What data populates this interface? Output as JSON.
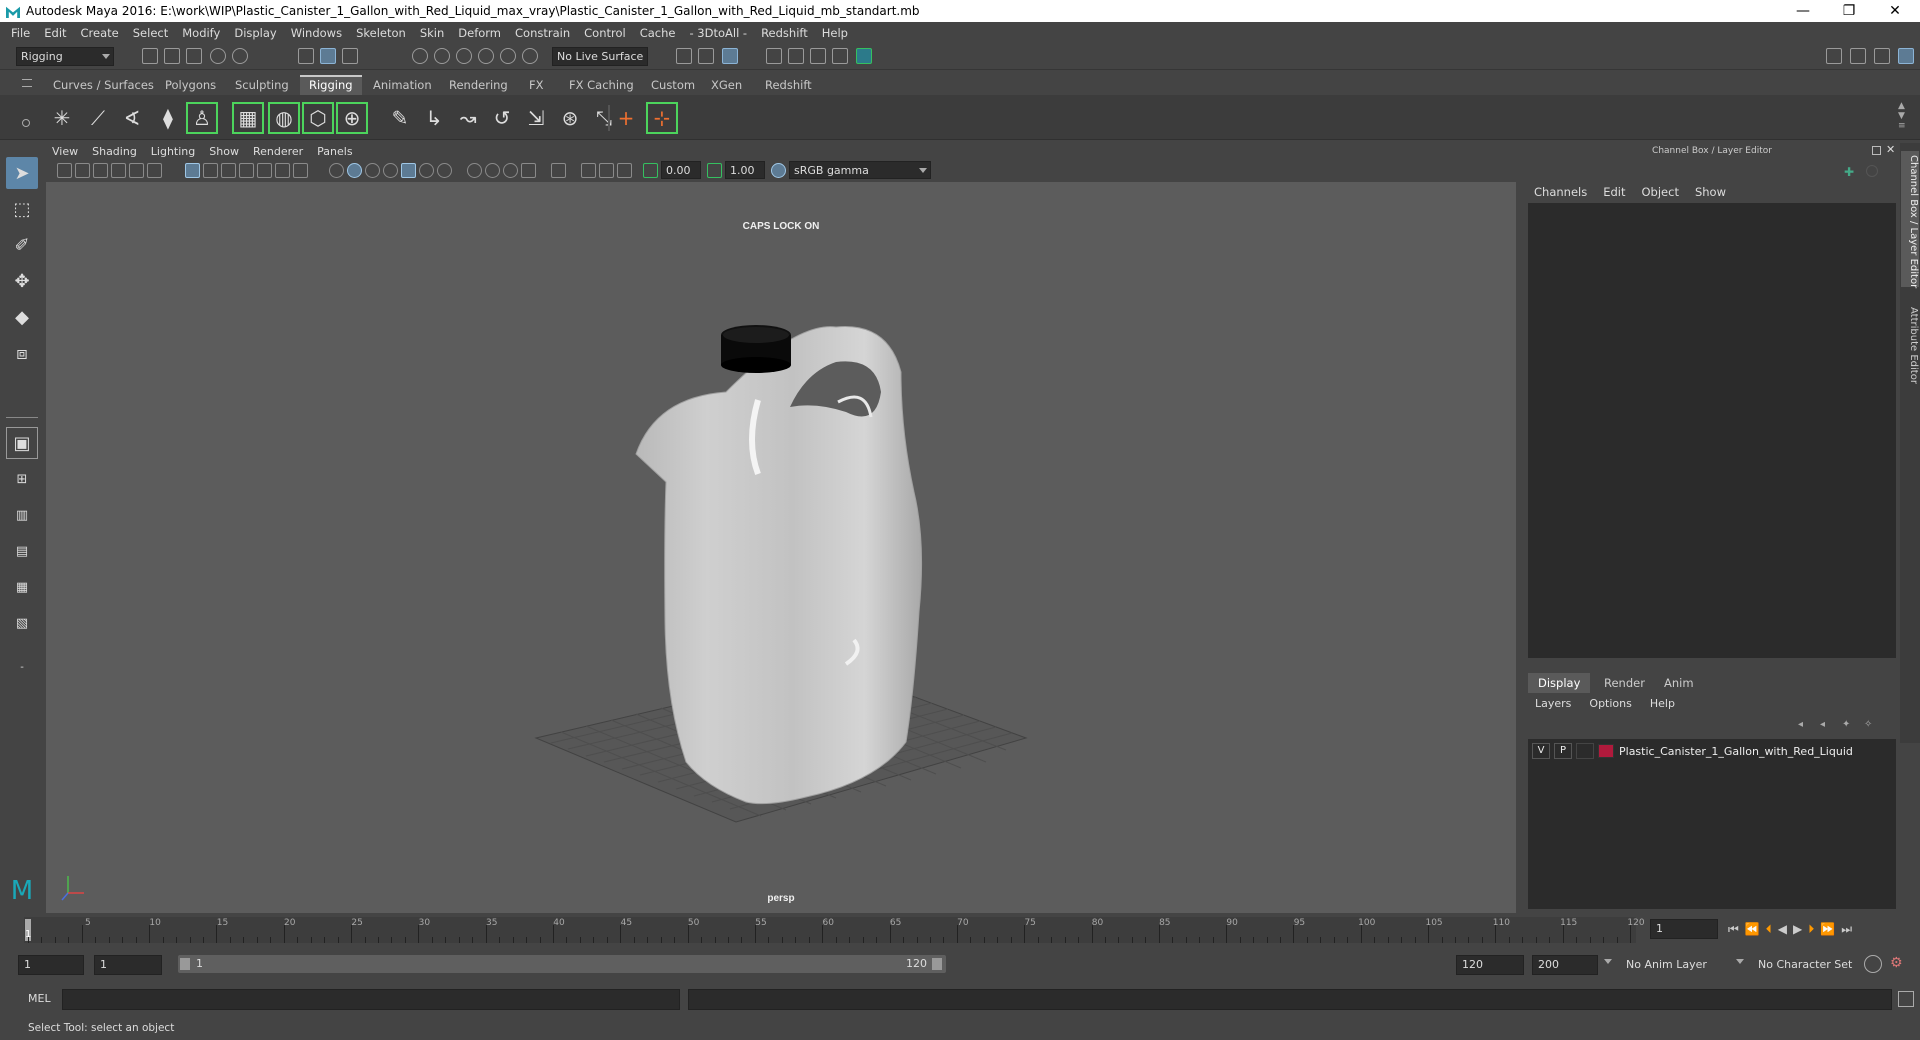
{
  "window": {
    "title": "Autodesk Maya 2016: E:\\work\\WIP\\Plastic_Canister_1_Gallon_with_Red_Liquid_max_vray\\Plastic_Canister_1_Gallon_with_Red_Liquid_mb_standart.mb",
    "minimize": "—",
    "restore": "❐",
    "close": "✕"
  },
  "menubar": [
    "File",
    "Edit",
    "Create",
    "Select",
    "Modify",
    "Display",
    "Windows",
    "Skeleton",
    "Skin",
    "Deform",
    "Constrain",
    "Control",
    "Cache",
    "- 3DtoAll -",
    "Redshift",
    "Help"
  ],
  "statusline": {
    "mode": "Rigging",
    "live_surface": "No Live Surface"
  },
  "shelf_tabs": [
    "Curves / Surfaces",
    "Polygons",
    "Sculpting",
    "Rigging",
    "Animation",
    "Rendering",
    "FX",
    "FX Caching",
    "Custom",
    "XGen",
    "Redshift"
  ],
  "shelf_active": "Rigging",
  "panel_menu": [
    "View",
    "Shading",
    "Lighting",
    "Show",
    "Renderer",
    "Panels"
  ],
  "panel_toolbar": {
    "exposure": "0.00",
    "gamma": "1.00",
    "colorspace": "sRGB gamma"
  },
  "viewport": {
    "caps_message": "CAPS LOCK ON",
    "camera": "persp"
  },
  "channel_box": {
    "title": "Channel Box / Layer Editor",
    "menu": [
      "Channels",
      "Edit",
      "Object",
      "Show"
    ]
  },
  "layer_editor": {
    "tabs": [
      "Display",
      "Render",
      "Anim"
    ],
    "active_tab": "Display",
    "menu": [
      "Layers",
      "Options",
      "Help"
    ],
    "layers": [
      {
        "visible": "V",
        "playback": "P",
        "name": "Plastic_Canister_1_Gallon_with_Red_Liquid",
        "color": "#b01a3c"
      }
    ]
  },
  "side_tabs": [
    "Channel Box / Layer Editor",
    "Attribute Editor"
  ],
  "timeline": {
    "start": 1,
    "end": 120,
    "current": 1,
    "labels": [
      "5",
      "10",
      "15",
      "20",
      "25",
      "30",
      "35",
      "40",
      "45",
      "50",
      "55",
      "60",
      "65",
      "70",
      "75",
      "80",
      "85",
      "90",
      "95",
      "100",
      "105",
      "110",
      "115",
      "120"
    ],
    "current_frame_field": "1"
  },
  "range": {
    "start_field": "1",
    "playback_start": "1",
    "range_min": "1",
    "range_max": "120",
    "playback_end": "120",
    "end_field": "200",
    "anim_layer": "No Anim Layer",
    "character_set": "No Character Set"
  },
  "command_line": {
    "language": "MEL"
  },
  "help_line": "Select Tool: select an object",
  "colors": {
    "panel_bg": "#444444",
    "viewport_bg": "#5c5c5c",
    "highlight": "#5d86a8",
    "layer_color": "#b01a3c",
    "shelf_outline": "#4cd45c"
  }
}
